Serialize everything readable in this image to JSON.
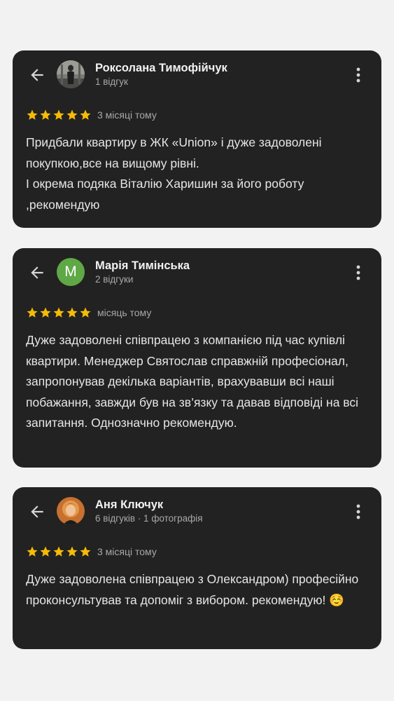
{
  "colors": {
    "background": "#f2f2f2",
    "card": "#222222",
    "star": "#f6bb06",
    "avatar_m": "#5fa846"
  },
  "icons": {
    "back": "arrow-left-icon",
    "more": "more-vertical-icon",
    "star": "star-icon"
  },
  "reviews": [
    {
      "name": "Роксолана Тимофійчук",
      "meta": "1 відгук",
      "rating": 5,
      "date": "3 місяці тому",
      "text": "Придбали квартиру в ЖК «Union» і дуже задоволені покупкою,все на вищому рівні.\nІ окрема подяка Віталію Харишин за його роботу ,рекомендую"
    },
    {
      "name": "Марія Тимінська",
      "avatar_letter": "M",
      "meta": "2 відгуки",
      "rating": 5,
      "date": "місяць тому",
      "text": "Дуже задоволені співпрацею з компанією під час купівлі квартири. Менеджер Святослав справжній професіонал, запропонував декілька варіантів, врахувавши всі наші побажання, завжди був на зв’язку та давав відповіді на всі запитання. Однозначно рекомендую."
    },
    {
      "name": "Аня Ключук",
      "meta": "6 відгуків · 1 фотографія",
      "rating": 5,
      "date": "3 місяці тому",
      "text": "Дуже задоволена співпрацею з Олександром) професійно проконсультував та допоміг з вибором. рекомендую! ☺️"
    }
  ]
}
